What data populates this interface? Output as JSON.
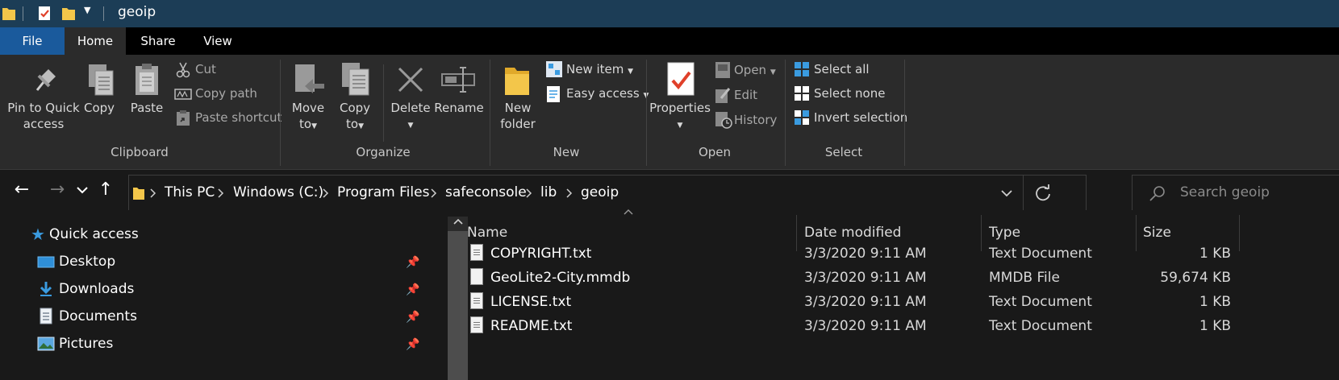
{
  "window": {
    "title": "geoip"
  },
  "ribbon_tabs": [
    "File",
    "Home",
    "Share",
    "View"
  ],
  "ribbon": {
    "clipboard": {
      "group_label": "Clipboard",
      "pin_label_1": "Pin to Quick",
      "pin_label_2": "access",
      "copy": "Copy",
      "paste": "Paste",
      "cut": "Cut",
      "copy_path": "Copy path",
      "paste_shortcut": "Paste shortcut"
    },
    "organize": {
      "group_label": "Organize",
      "move_to_1": "Move",
      "move_to_2": "to",
      "copy_to_1": "Copy",
      "copy_to_2": "to",
      "delete": "Delete",
      "rename": "Rename"
    },
    "new": {
      "group_label": "New",
      "new_folder_1": "New",
      "new_folder_2": "folder",
      "new_item": "New item",
      "easy_access": "Easy access"
    },
    "open": {
      "group_label": "Open",
      "properties": "Properties",
      "open": "Open",
      "edit": "Edit",
      "history": "History"
    },
    "select": {
      "group_label": "Select",
      "select_all": "Select all",
      "select_none": "Select none",
      "invert_selection": "Invert selection"
    }
  },
  "address": {
    "breadcrumb": [
      "This PC",
      "Windows (C:)",
      "Program Files",
      "safeconsole",
      "lib",
      "geoip"
    ],
    "search_placeholder": "Search geoip"
  },
  "nav_pane": {
    "quick_access": "Quick access",
    "items": [
      {
        "label": "Desktop",
        "icon": "desktop-icon"
      },
      {
        "label": "Downloads",
        "icon": "downloads-icon"
      },
      {
        "label": "Documents",
        "icon": "documents-icon"
      },
      {
        "label": "Pictures",
        "icon": "pictures-icon"
      }
    ]
  },
  "file_list": {
    "columns": [
      "Name",
      "Date modified",
      "Type",
      "Size"
    ],
    "rows": [
      {
        "name": "COPYRIGHT.txt",
        "date": "3/3/2020 9:11 AM",
        "type": "Text Document",
        "size": "1 KB"
      },
      {
        "name": "GeoLite2-City.mmdb",
        "date": "3/3/2020 9:11 AM",
        "type": "MMDB File",
        "size": "59,674 KB"
      },
      {
        "name": "LICENSE.txt",
        "date": "3/3/2020 9:11 AM",
        "type": "Text Document",
        "size": "1 KB"
      },
      {
        "name": "README.txt",
        "date": "3/3/2020 9:11 AM",
        "type": "Text Document",
        "size": "1 KB"
      }
    ]
  },
  "colors": {
    "titlebar": "#1c3d56",
    "file_tab": "#1a5a9c",
    "ribbon": "#2b2b2b",
    "background": "#191919",
    "folder": "#f3c64a",
    "accent_blue": "#3a9be0"
  }
}
